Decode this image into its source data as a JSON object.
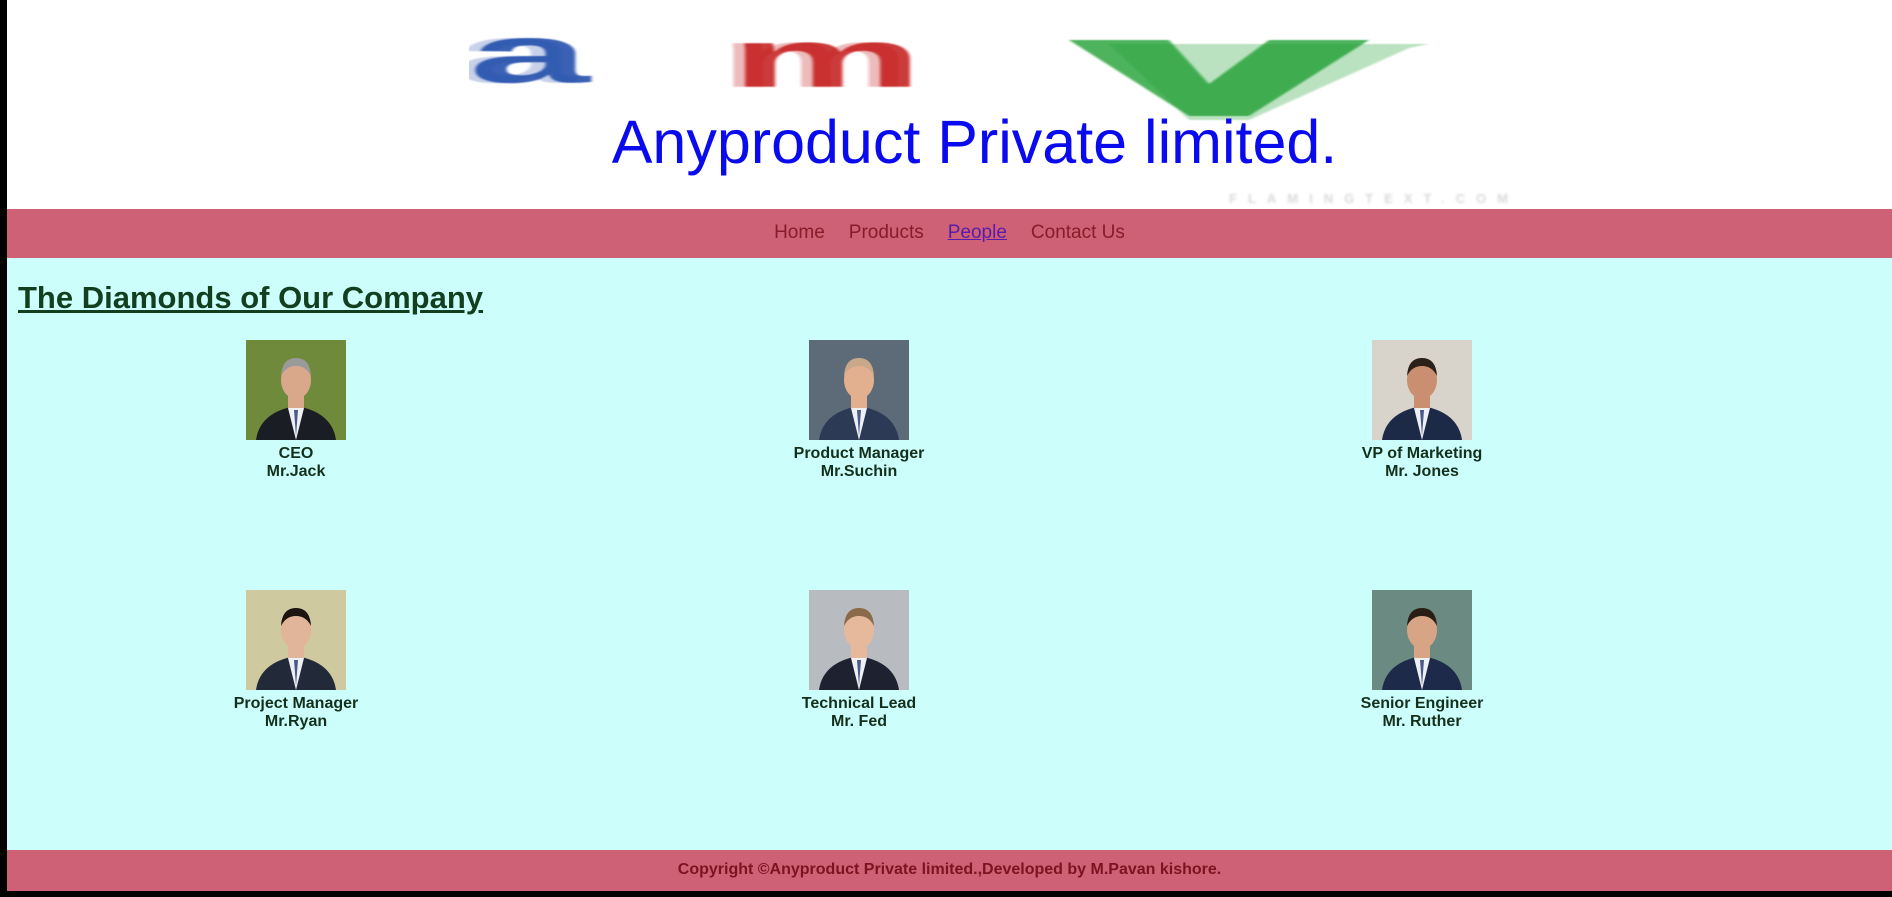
{
  "header": {
    "logo_text": "any",
    "company_name": "Anyproduct Private limited.",
    "watermark": "FLAMINGTEXT.COM"
  },
  "nav": {
    "items": [
      {
        "label": "Home",
        "active": false
      },
      {
        "label": "Products",
        "active": false
      },
      {
        "label": "People",
        "active": true
      },
      {
        "label": "Contact Us",
        "active": false
      }
    ]
  },
  "main": {
    "title": "The Diamonds of Our Company",
    "people": [
      {
        "role": "CEO",
        "name": "Mr.Jack"
      },
      {
        "role": "Product Manager",
        "name": "Mr.Suchin"
      },
      {
        "role": "VP of Marketing",
        "name": "Mr. Jones"
      },
      {
        "role": "Project Manager",
        "name": "Mr.Ryan"
      },
      {
        "role": "Technical Lead",
        "name": "Mr. Fed"
      },
      {
        "role": "Senior Engineer",
        "name": "Mr. Ruther"
      }
    ]
  },
  "footer": {
    "copyright": "Copyright ©Anyproduct Private limited.,Developed by M.Pavan kishore."
  },
  "colors": {
    "background": "#ccfffb",
    "nav_bar": "#ce6175",
    "company_name": "#0a0aee",
    "logo_a": "#1a46a8",
    "logo_n": "#c41818",
    "logo_y": "#22a032"
  }
}
